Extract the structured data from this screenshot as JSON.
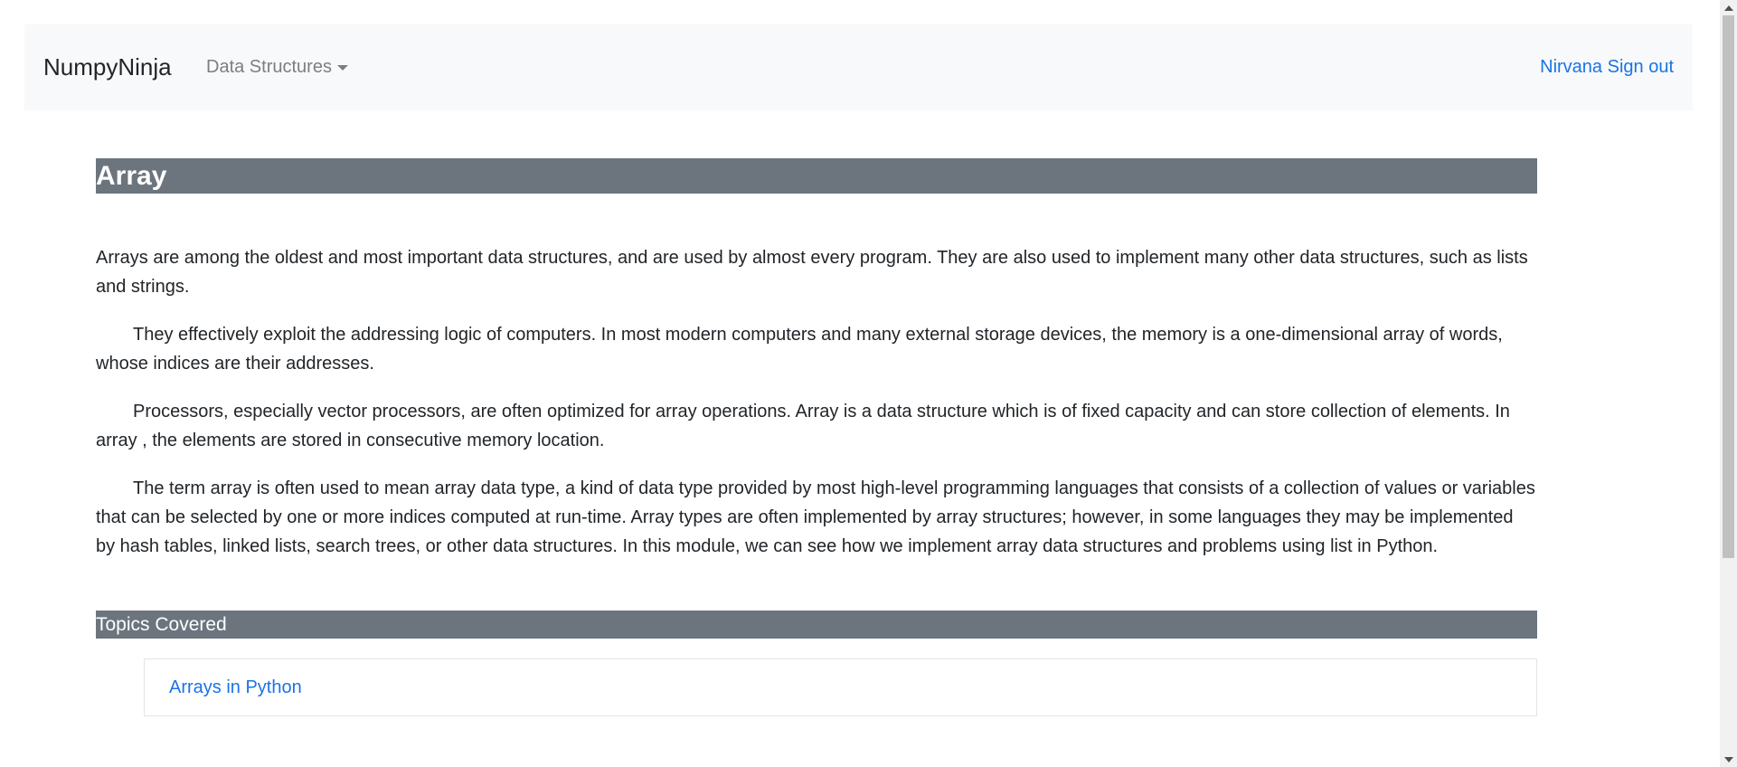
{
  "navbar": {
    "brand": "NumpyNinja",
    "dropdown_label": "Data Structures",
    "user_name": "Nirvana",
    "signout_label": "Sign out"
  },
  "main": {
    "title": "Array",
    "paragraphs": [
      "Arrays are among the oldest and most important data structures, and are used by almost every program. They are also used to implement many other data structures, such as lists and strings.",
      "They effectively exploit the addressing logic of computers. In most modern computers and many external storage devices, the memory is a one-dimensional array of words, whose indices are their addresses.",
      "Processors, especially vector processors, are often optimized for array operations. Array is a data structure which is of fixed capacity and can store collection of elements. In array , the elements are stored in consecutive memory location.",
      "The term array is often used to mean array data type, a kind of data type provided by most high-level programming languages that consists of a collection of values or variables that can be selected by one or more indices computed at run-time. Array types are often implemented by array structures; however, in some languages they may be implemented by hash tables, linked lists, search trees, or other data structures. In this module, we can see how we implement array data structures and problems using list in Python."
    ],
    "topics_heading": "Topics Covered",
    "topics": [
      {
        "label": "Arrays in Python"
      }
    ]
  },
  "colors": {
    "navbar_bg": "#f8f9fa",
    "section_bar_bg": "#6c757d",
    "link": "#1a73e8"
  }
}
